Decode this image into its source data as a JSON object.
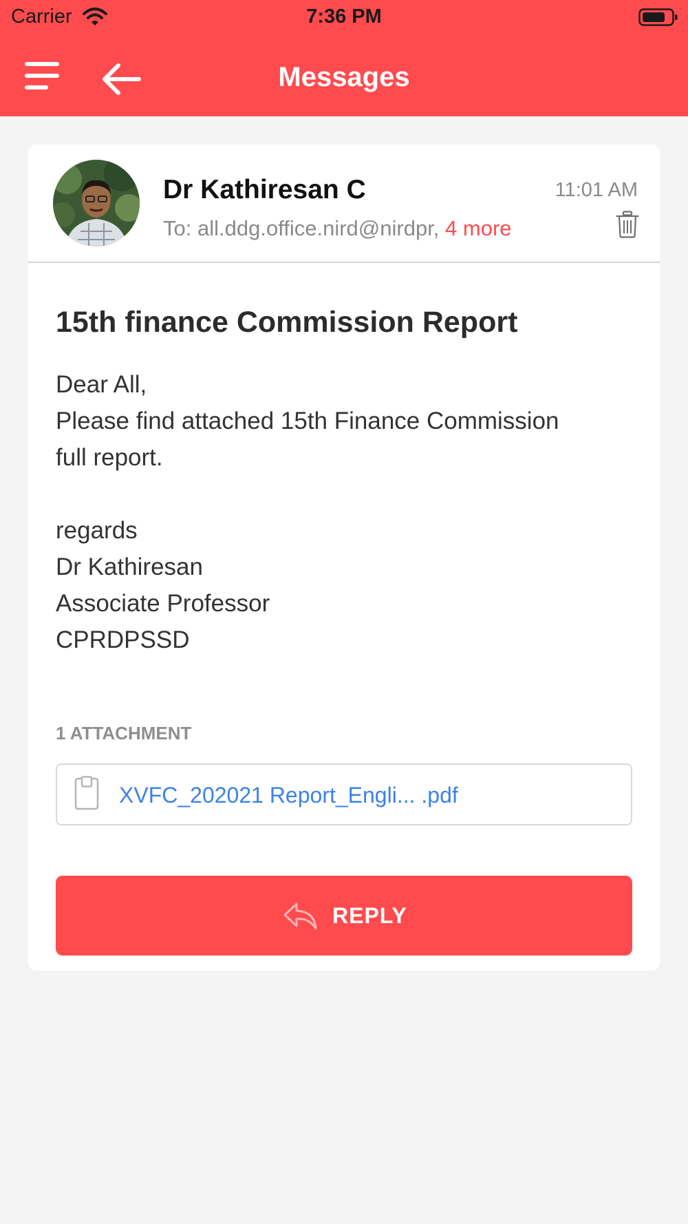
{
  "status_bar": {
    "carrier": "Carrier",
    "time": "7:36 PM"
  },
  "nav": {
    "title": "Messages",
    "menu_icon": "menu-icon",
    "back_icon": "back-arrow-icon"
  },
  "message": {
    "sender": "Dr Kathiresan C",
    "to_label": "To:",
    "to_address": "all.ddg.office.nird@nirdpr,",
    "more_recipients": "4 more",
    "time": "11:01 AM",
    "subject": "15th finance Commission Report",
    "body": {
      "line1": "Dear All,",
      "line2": "Please find attached 15th Finance Commission",
      "line3": "full report.",
      "line4": "regards",
      "line5": "Dr Kathiresan",
      "line6": "Associate Professor",
      "line7": "CPRDPSSD"
    }
  },
  "attachments": {
    "label": "1 ATTACHMENT",
    "items": [
      {
        "name": "XVFC_202021 Report_Engli... .pdf",
        "icon": "file-icon"
      }
    ]
  },
  "actions": {
    "reply_label": "REPLY",
    "reply_icon": "reply-icon",
    "delete_icon": "trash-icon"
  },
  "colors": {
    "accent": "#ff4b4e",
    "link": "#3d82e6",
    "background": "#f4f4f4"
  }
}
